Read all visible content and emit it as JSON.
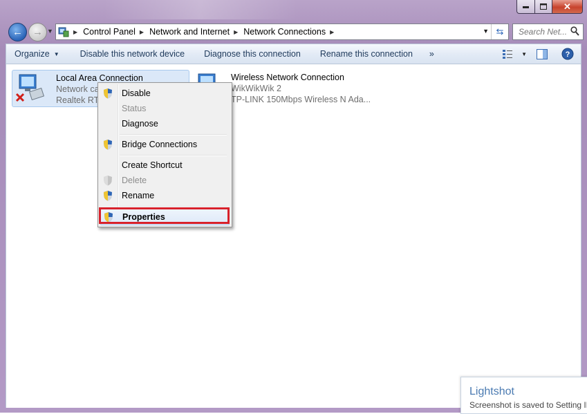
{
  "window": {
    "min_icon": "minimize-icon",
    "max_icon": "maximize-icon",
    "close_label": "✕"
  },
  "nav": {
    "breadcrumbs": [
      "Control Panel",
      "Network and Internet",
      "Network Connections"
    ],
    "search_placeholder": "Search Net..."
  },
  "toolbar": {
    "organize": "Organize",
    "disable": "Disable this network device",
    "diagnose": "Diagnose this connection",
    "rename": "Rename this connection",
    "more": "»"
  },
  "connections": [
    {
      "name": "Local Area Connection",
      "status": "Network ca",
      "adapter": "Realtek RTL",
      "disconnected": true
    },
    {
      "name": "Wireless Network Connection",
      "status": "WikWikWik  2",
      "adapter": "TP-LINK 150Mbps Wireless N Ada..."
    }
  ],
  "context_menu": {
    "items": [
      {
        "label": "Disable",
        "shield": true,
        "disabled": false
      },
      {
        "label": "Status",
        "shield": false,
        "disabled": true
      },
      {
        "label": "Diagnose",
        "shield": false,
        "disabled": false
      },
      {
        "label": "Bridge Connections",
        "shield": true,
        "disabled": false
      },
      {
        "label": "Create Shortcut",
        "shield": false,
        "disabled": false
      },
      {
        "label": "Delete",
        "shield": true,
        "disabled": true
      },
      {
        "label": "Rename",
        "shield": true,
        "disabled": false
      },
      {
        "label": "Properties",
        "shield": true,
        "disabled": false,
        "highlighted": true
      }
    ]
  },
  "toast": {
    "title": "Lightshot",
    "message": "Screenshot is saved to Setting IP"
  },
  "colors": {
    "highlight_box": "#d7212b",
    "frame": "#b39ac6"
  }
}
